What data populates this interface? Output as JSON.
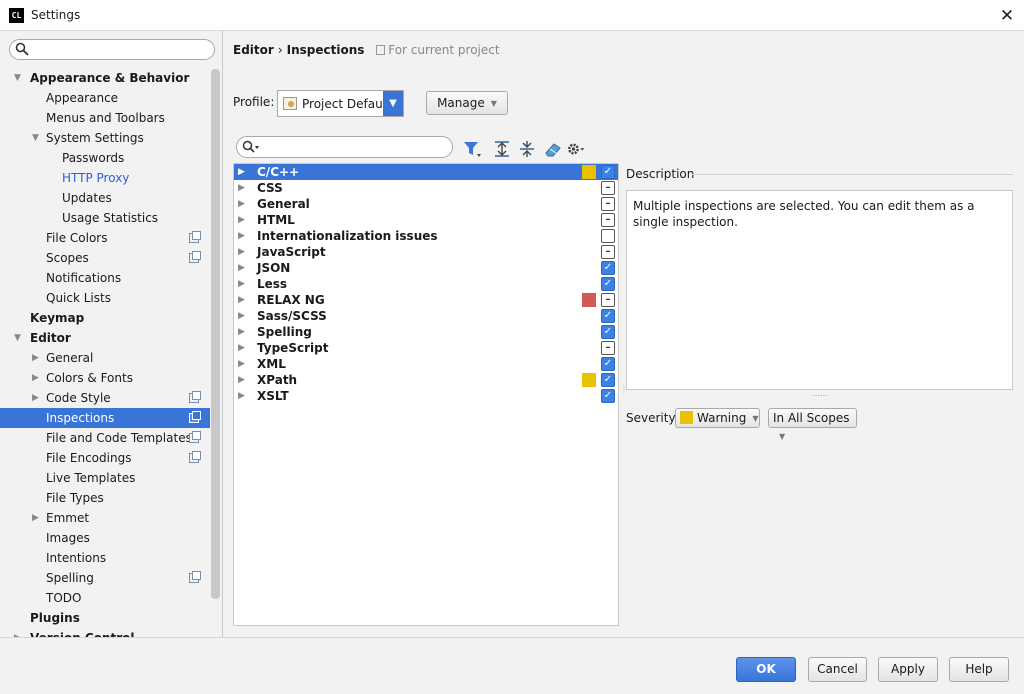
{
  "window": {
    "title": "Settings",
    "icon_text": "CL",
    "close_label": "✕"
  },
  "sidebar": {
    "search_placeholder": "",
    "items": [
      {
        "label": "Appearance & Behavior",
        "level": 0,
        "arrow": "▼"
      },
      {
        "label": "Appearance",
        "level": 1
      },
      {
        "label": "Menus and Toolbars",
        "level": 1
      },
      {
        "label": "System Settings",
        "level": 1,
        "arrow": "▼"
      },
      {
        "label": "Passwords",
        "level": 2
      },
      {
        "label": "HTTP Proxy",
        "level": 2,
        "link": true
      },
      {
        "label": "Updates",
        "level": 2
      },
      {
        "label": "Usage Statistics",
        "level": 2
      },
      {
        "label": "File Colors",
        "level": 1,
        "copy": true
      },
      {
        "label": "Scopes",
        "level": 1,
        "copy": true
      },
      {
        "label": "Notifications",
        "level": 1
      },
      {
        "label": "Quick Lists",
        "level": 1
      },
      {
        "label": "Keymap",
        "level": 0
      },
      {
        "label": "Editor",
        "level": 0,
        "arrow": "▼"
      },
      {
        "label": "General",
        "level": 1,
        "arrow": "▶"
      },
      {
        "label": "Colors & Fonts",
        "level": 1,
        "arrow": "▶"
      },
      {
        "label": "Code Style",
        "level": 1,
        "arrow": "▶",
        "copy": true
      },
      {
        "label": "Inspections",
        "level": 1,
        "selected": true,
        "copy": true
      },
      {
        "label": "File and Code Templates",
        "level": 1,
        "copy": true
      },
      {
        "label": "File Encodings",
        "level": 1,
        "copy": true
      },
      {
        "label": "Live Templates",
        "level": 1
      },
      {
        "label": "File Types",
        "level": 1
      },
      {
        "label": "Emmet",
        "level": 1,
        "arrow": "▶"
      },
      {
        "label": "Images",
        "level": 1
      },
      {
        "label": "Intentions",
        "level": 1
      },
      {
        "label": "Spelling",
        "level": 1,
        "copy": true
      },
      {
        "label": "TODO",
        "level": 1
      },
      {
        "label": "Plugins",
        "level": 0
      },
      {
        "label": "Version Control",
        "level": 0,
        "arrow": "▶"
      }
    ]
  },
  "breadcrumb": {
    "section": "Editor",
    "sep": "›",
    "page": "Inspections",
    "scope": "For current project"
  },
  "profile": {
    "label": "Profile:",
    "value": "Project Default",
    "manage_label": "Manage"
  },
  "filter": {
    "placeholder": ""
  },
  "inspections": [
    {
      "name": "C/C++",
      "check": "on",
      "sev": "#e8c200",
      "selected": true
    },
    {
      "name": "CSS",
      "check": "partial"
    },
    {
      "name": "General",
      "check": "partial"
    },
    {
      "name": "HTML",
      "check": "partial"
    },
    {
      "name": "Internationalization issues",
      "check": "off"
    },
    {
      "name": "JavaScript",
      "check": "partial"
    },
    {
      "name": "JSON",
      "check": "on"
    },
    {
      "name": "Less",
      "check": "on"
    },
    {
      "name": "RELAX NG",
      "check": "partial",
      "sev": "#cf5b56"
    },
    {
      "name": "Sass/SCSS",
      "check": "on"
    },
    {
      "name": "Spelling",
      "check": "on"
    },
    {
      "name": "TypeScript",
      "check": "partial"
    },
    {
      "name": "XML",
      "check": "on"
    },
    {
      "name": "XPath",
      "check": "on",
      "sev": "#e8c200"
    },
    {
      "name": "XSLT",
      "check": "on"
    }
  ],
  "description": {
    "label": "Description",
    "text": "Multiple inspections are selected. You can edit them as a single inspection."
  },
  "severity": {
    "label": "Severity:",
    "value": "Warning",
    "scope": "In All Scopes",
    "color": "#e8c200"
  },
  "footer": {
    "ok": "OK",
    "cancel": "Cancel",
    "apply": "Apply",
    "help": "Help"
  }
}
